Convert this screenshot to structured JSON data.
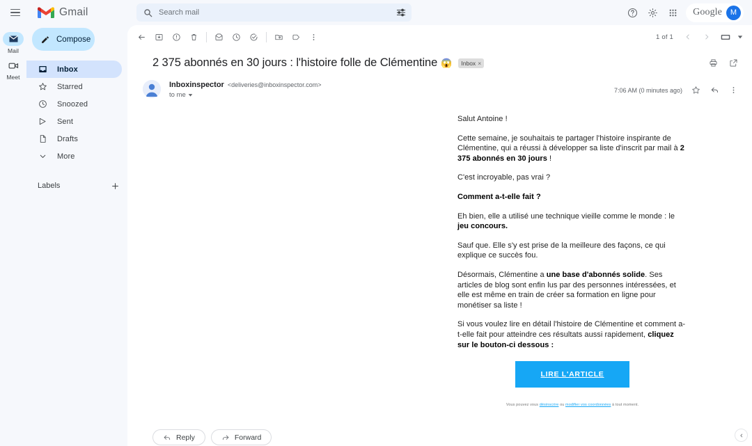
{
  "app": {
    "brand_name": "Gmail",
    "menu_icon": "hamburger-icon"
  },
  "search": {
    "placeholder": "Search mail",
    "value": "",
    "search_icon": "search-icon",
    "filter_icon": "tune-filter-icon"
  },
  "header_actions": {
    "help_icon": "help-icon",
    "settings_icon": "gear-icon",
    "apps_icon": "apps-grid-icon",
    "google_label": "Google",
    "avatar_initial": "M"
  },
  "rail": {
    "items": [
      {
        "label": "Mail",
        "icon": "mail-icon",
        "active": true
      },
      {
        "label": "Meet",
        "icon": "video-camera-icon",
        "active": false
      }
    ]
  },
  "sidebar": {
    "compose_label": "Compose",
    "compose_icon": "pencil-icon",
    "items": [
      {
        "label": "Inbox",
        "icon": "inbox-icon",
        "active": true
      },
      {
        "label": "Starred",
        "icon": "star-icon",
        "active": false
      },
      {
        "label": "Snoozed",
        "icon": "clock-icon",
        "active": false
      },
      {
        "label": "Sent",
        "icon": "send-icon",
        "active": false
      },
      {
        "label": "Drafts",
        "icon": "draft-file-icon",
        "active": false
      },
      {
        "label": "More",
        "icon": "chevron-down-icon",
        "active": false
      }
    ],
    "labels_title": "Labels",
    "labels_add_icon": "plus-icon"
  },
  "toolbar": {
    "back_icon": "arrow-back-icon",
    "archive_icon": "archive-icon",
    "report_spam_icon": "report-spam-icon",
    "delete_icon": "trash-icon",
    "mark_unread_icon": "mark-unread-icon",
    "snooze_icon": "clock-icon",
    "add_task_icon": "add-task-icon",
    "move_to_icon": "move-folder-icon",
    "labels_icon": "label-tag-icon",
    "more_icon": "more-vertical-icon",
    "pager_text": "1 of 1",
    "prev_icon": "chevron-left-icon",
    "next_icon": "chevron-right-icon",
    "display_density_icon": "display-toggle-icon",
    "density_caret_icon": "caret-down-icon"
  },
  "message": {
    "subject": "2 375 abonnés en 30 jours : l'histoire folle de Clémentine",
    "subject_emoji": "😱",
    "label_chip": "Inbox",
    "label_chip_remove": "×",
    "print_icon": "print-icon",
    "open_new_window_icon": "open-in-new-icon",
    "sender_name": "Inboxinspector",
    "sender_email": "<deliveries@inboxinspector.com>",
    "recipient": "to me",
    "recipient_caret_icon": "caret-down-icon",
    "timestamp": "7:06 AM (0 minutes ago)",
    "star_icon": "star-outline-icon",
    "reply_icon": "reply-arrow-icon",
    "more_icon": "more-vertical-icon",
    "avatar_icon": "person-avatar-icon"
  },
  "email_body": {
    "greeting": "Salut Antoine !",
    "p1_part1": "Cette semaine, je souhaitais te partager l'histoire inspirante de Clémentine, qui a réussi à développer sa liste d'inscrit par mail à ",
    "p1_bold": "2 375 abonnés en 30 jours",
    "p1_part2": " !",
    "p2": "C'est incroyable, pas vrai ?",
    "p3_bold": "Comment a-t-elle fait ?",
    "p4_part1": "Eh bien, elle a utilisé une technique vieille comme le monde : le ",
    "p4_bold": "jeu concours.",
    "p5": "Sauf que. Elle s'y est prise de la meilleure des façons, ce qui explique ce succès fou.",
    "p6_part1": "Désormais, Clémentine a ",
    "p6_bold": "une base d'abonnés solide",
    "p6_part2": ". Ses articles de blog sont enfin lus par des personnes intéressées, et elle est même en train de créer sa formation en ligne pour monétiser sa liste !",
    "p7_part1": "Si vous voulez lire en détail l'histoire de Clémentine et comment a-t-elle fait pour atteindre ces résultats aussi rapidement, ",
    "p7_bold": "cliquez sur le bouton-ci dessous :",
    "cta_label": "LIRE L'ARTICLE",
    "cta_color": "#16a7f5",
    "footer_part1": "Vous pouvez vous ",
    "footer_link1": "désinscrire",
    "footer_part2": " ou ",
    "footer_link2": "modifier vos coordonnées",
    "footer_part3": " à tout moment."
  },
  "reply_bar": {
    "reply_label": "Reply",
    "reply_icon": "reply-arrow-icon",
    "forward_label": "Forward",
    "forward_icon": "forward-arrow-icon"
  },
  "corner": {
    "collapse_icon": "chevron-left-icon"
  },
  "colors": {
    "accent_blue": "#1a73e8",
    "compose_bg": "#c2e7ff",
    "nav_active_bg": "#d3e3fd",
    "page_bg": "#f6f8fc",
    "cta_blue": "#16a7f5"
  }
}
